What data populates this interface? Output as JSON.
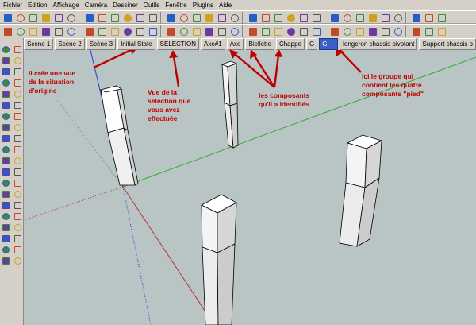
{
  "menubar": {
    "items": [
      "Fichier",
      "Édition",
      "Affichage",
      "Caméra",
      "Dessiner",
      "Outils",
      "Fenêtre",
      "Plugins",
      "Aide"
    ]
  },
  "toolbar_icons": [
    "select-tool-icon",
    "paint-bucket-icon",
    "undo-icon",
    "redo-icon",
    "print-icon",
    "component-icon",
    "camera-icon",
    "house-icon",
    "box-icon",
    "walk-icon",
    "zoom-icon",
    "orbit-icon",
    "pan-icon",
    "section-plane-icon",
    "shadow-icon",
    "fog-icon",
    "xray-icon",
    "wireframe-icon",
    "hidden-line-icon",
    "shaded-icon",
    "textured-icon",
    "monochrome-icon"
  ],
  "scene_tabs": [
    {
      "label": "Scène 1",
      "active": false
    },
    {
      "label": "Scène 2",
      "active": false
    },
    {
      "label": "Scène 3",
      "active": false
    },
    {
      "label": "Initial State",
      "active": false
    },
    {
      "label": "SELECTION",
      "active": false
    },
    {
      "label": "Axe#1",
      "active": false
    },
    {
      "label": "Axe",
      "active": false
    },
    {
      "label": "Biellette",
      "active": false
    },
    {
      "label": "Chappe",
      "active": false
    },
    {
      "label": "G",
      "active": false
    },
    {
      "label": "G",
      "active": true
    },
    {
      "label": "longeron chassis pivotant",
      "active": false
    },
    {
      "label": "Support chassis p",
      "active": false
    }
  ],
  "annotations": {
    "initial_state": "il crée une vue\nde la situation\nd'origine",
    "selection": "Vue de la\nsélection que\nvous avez\neffectuée",
    "components": "les composants\nqu'il a identifiés",
    "group": "ici le groupe qui\ncontient les quatre\ncomposants \"pied\""
  },
  "colors": {
    "annotation": "#c00000",
    "viewport_bg": "#b9c4c4",
    "active_tab": "#3b5fc2",
    "axis_green": "#2eae2e",
    "axis_red": "#c03030",
    "axis_blue": "#2a3ad0"
  }
}
